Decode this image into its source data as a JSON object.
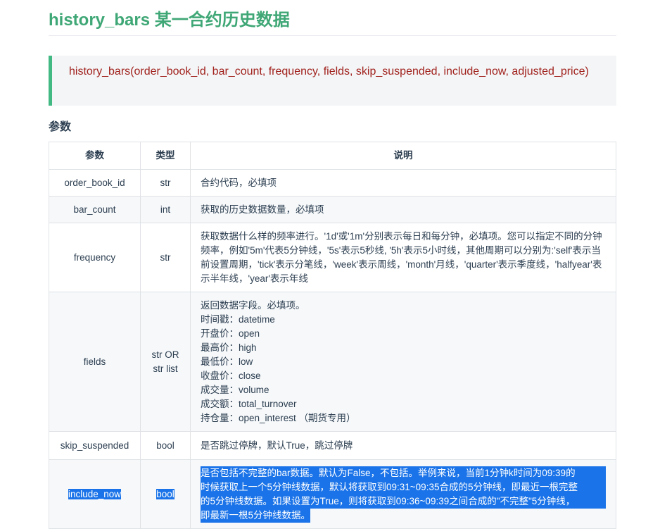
{
  "title": "history_bars 某一合约历史数据",
  "signature": "history_bars(order_book_id, bar_count, frequency, fields, skip_suspended, include_now, adjusted_price)",
  "section_heading": "参数",
  "table": {
    "headers": [
      "参数",
      "类型",
      "说明"
    ],
    "rows": [
      {
        "name": "order_book_id",
        "type": "str",
        "desc": "合约代码，必填项"
      },
      {
        "name": "bar_count",
        "type": "int",
        "desc": "获取的历史数据数量，必填项"
      },
      {
        "name": "frequency",
        "type": "str",
        "desc": "获取数据什么样的频率进行。'1d'或'1m'分别表示每日和每分钟，必填项。您可以指定不同的分钟频率，例如'5m'代表5分钟线，'5s'表示5秒线, '5h'表示5小时线，其他周期可以分别为:'self'表示当前设置周期，'tick'表示分笔线，'week'表示周线，'month'月线，'quarter'表示季度线，'halfyear'表示半年线，'year'表示年线"
      },
      {
        "name": "fields",
        "type_lines": [
          "str OR",
          "str list"
        ],
        "desc_lines": [
          "返回数据字段。必填项。",
          "时间戳：datetime",
          "开盘价：open",
          "最高价：high",
          "最低价：low",
          "收盘价：close",
          "成交量：volume",
          "成交额：total_turnover",
          "持仓量：open_interest （期货专用）"
        ]
      },
      {
        "name": "skip_suspended",
        "type": "bool",
        "desc": "是否跳过停牌，默认True，跳过停牌"
      },
      {
        "name": "include_now",
        "type": "bool",
        "desc_lines": [
          "是否包括不完整的bar数据。默认为False，不包括。举例来说，当前1分钟k时间为09:39的",
          "时候获取上一个5分钟线数据，默认将获取到09:31~09:35合成的5分钟线，即最近一根完整",
          "的5分钟线数据。如果设置为True，则将获取到09:36~09:39之间合成的\"不完整\"5分钟线，",
          "即最新一根5分钟线数据。"
        ]
      }
    ]
  },
  "colors": {
    "title": "#3fa776",
    "signature_text": "#a1221d",
    "accent_border": "#42b983",
    "selection": "#1a73e8"
  }
}
